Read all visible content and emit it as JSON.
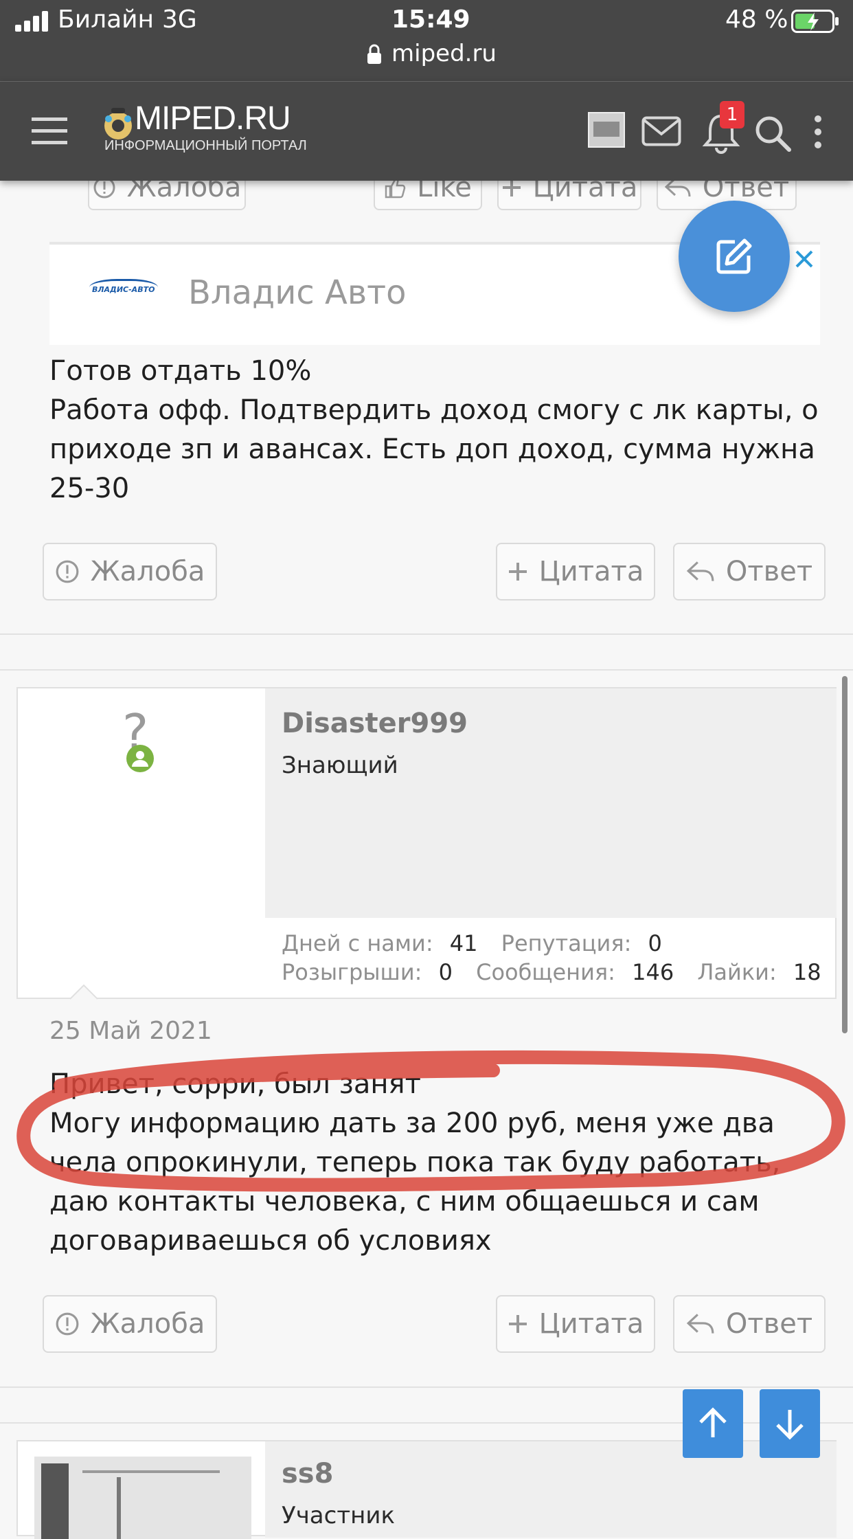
{
  "status_bar": {
    "carrier": "Билайн",
    "network": "3G",
    "time": "15:49",
    "battery": "48 %",
    "url": "miped.ru"
  },
  "header": {
    "logo_title": "MIPED.RU",
    "logo_subtitle": "ИНФОРМАЦИОННЫЙ ПОРТАЛ",
    "notification_count": "1"
  },
  "post_top": {
    "report": "Жалоба",
    "like": "Like",
    "quote": "Цитата",
    "reply": "Ответ"
  },
  "ad": {
    "logo_text": "ВЛАДИС-АВТО",
    "title": "Владис Авто"
  },
  "post1": {
    "text": "Готов отдать 10%\nРабота офф. Подтвердить доход смогу с лк карты, о приходе зп и авансах. Есть доп доход, сумма нужна 25-30",
    "report": "Жалоба",
    "quote": "Цитата",
    "reply": "Ответ"
  },
  "post2": {
    "avatar_symbol": "?",
    "username": "Disaster999",
    "user_title": "Знающий",
    "stats": {
      "days_label": "Дней с нами:",
      "days": "41",
      "rep_label": "Репутация:",
      "rep": "0",
      "draws_label": "Розыгрыши:",
      "draws": "0",
      "msgs_label": "Сообщения:",
      "msgs": "146",
      "likes_label": "Лайки:",
      "likes": "18"
    },
    "date": "25 Май 2021",
    "text": "Привет, сорри, был занят\nМогу информацию дать за 200 руб, меня уже два чела опрокинули, теперь пока так буду работать, даю контакты человека, с ним общаешься и сам договариваешься об условиях",
    "report": "Жалоба",
    "quote": "Цитата",
    "reply": "Ответ"
  },
  "post3": {
    "username": "ss8",
    "user_title": "Участник"
  },
  "colors": {
    "bar": "#474747",
    "fab": "#4a90d9",
    "scroll_btn": "#3f8ddb",
    "badge": "#e8363d",
    "annotation": "#d9453a",
    "online": "#7cb342"
  }
}
